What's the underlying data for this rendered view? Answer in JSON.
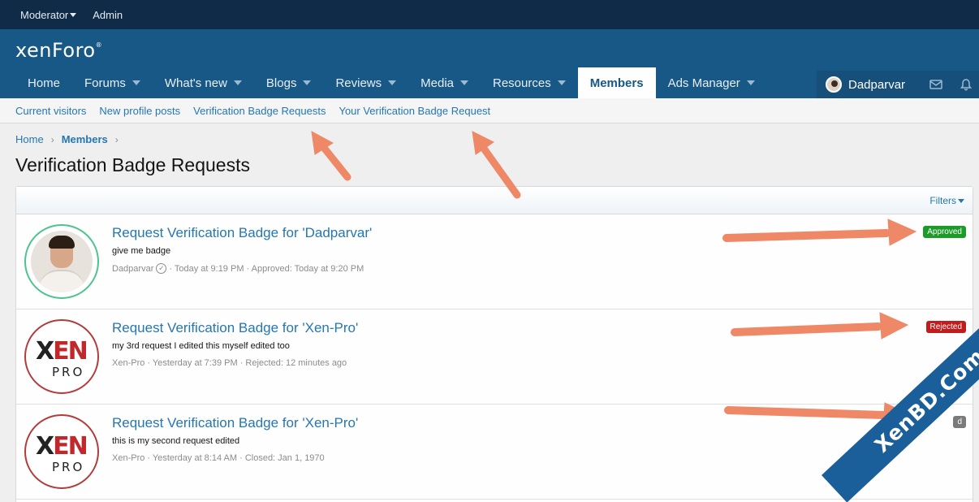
{
  "staff_bar": {
    "moderator": "Moderator",
    "admin": "Admin"
  },
  "logo": {
    "text": "xenForo",
    "mark": "®"
  },
  "nav": {
    "items": [
      {
        "label": "Home",
        "has_menu": false
      },
      {
        "label": "Forums",
        "has_menu": true
      },
      {
        "label": "What's new",
        "has_menu": true
      },
      {
        "label": "Blogs",
        "has_menu": true
      },
      {
        "label": "Reviews",
        "has_menu": true
      },
      {
        "label": "Media",
        "has_menu": true
      },
      {
        "label": "Resources",
        "has_menu": true
      },
      {
        "label": "Members",
        "has_menu": false,
        "active": true
      },
      {
        "label": "Ads Manager",
        "has_menu": true
      }
    ],
    "user": {
      "name": "Dadparvar"
    },
    "icons": [
      "inbox-icon",
      "bell-icon"
    ]
  },
  "subnav": {
    "items": [
      "Current visitors",
      "New profile posts",
      "Verification Badge Requests",
      "Your Verification Badge Request"
    ]
  },
  "breadcrumb": {
    "home": "Home",
    "members": "Members",
    "sep": "›"
  },
  "page": {
    "title": "Verification Badge Requests"
  },
  "filters": {
    "label": "Filters"
  },
  "requests": [
    {
      "title": "Request Verification Badge for 'Dadparvar'",
      "message": "give me badge",
      "user": "Dadparvar",
      "meta": "· Today at 9:19 PM · Approved: Today at 9:20 PM",
      "status": "Approved",
      "status_color": "#1b9b28"
    },
    {
      "title": "Request Verification Badge for 'Xen-Pro'",
      "message": "my 3rd request I edited this myself edited too",
      "user": "Xen-Pro",
      "meta": "· Yesterday at 7:39 PM · Rejected: 12 minutes ago",
      "status": "Rejected",
      "status_color": "#c21c1c"
    },
    {
      "title": "Request Verification Badge for 'Xen-Pro'",
      "message": "this is my second request edited",
      "user": "Xen-Pro",
      "meta": "· Yesterday at 8:14 AM · Closed: Jan 1, 1970",
      "status": "d",
      "status_color": "#7a7a7a"
    }
  ],
  "avatar_logo": {
    "xen": "EN",
    "x": "X",
    "pro": "PRO"
  },
  "watermark": {
    "text": "XenBD.Com"
  },
  "colors": {
    "header": "#185886",
    "staff_bar": "#0f2b47",
    "link": "#2577b1",
    "arrow": "#ee8866"
  }
}
